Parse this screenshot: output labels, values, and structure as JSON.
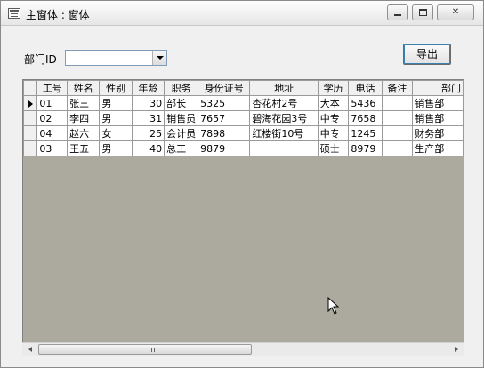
{
  "window": {
    "title": "主窗体 : 窗体"
  },
  "form": {
    "dept_label": "部门ID",
    "dept_value": "",
    "export_label": "导出"
  },
  "grid": {
    "columns": [
      "工号",
      "姓名",
      "性别",
      "年龄",
      "职务",
      "身份证号",
      "地址",
      "学历",
      "电话",
      "备注",
      "部门"
    ],
    "rows": [
      [
        "01",
        "张三",
        "男",
        "30",
        "部长",
        "5325",
        "杏花村2号",
        "大本",
        "5436",
        "",
        "销售部"
      ],
      [
        "02",
        "李四",
        "男",
        "31",
        "销售员",
        "7657",
        "碧海花园3号",
        "中专",
        "7658",
        "",
        "销售部"
      ],
      [
        "04",
        "赵六",
        "女",
        "25",
        "会计员",
        "7898",
        "红楼街10号",
        "中专",
        "1245",
        "",
        "财务部"
      ],
      [
        "03",
        "王五",
        "男",
        "40",
        "总工",
        "9879",
        "",
        "硕士",
        "8979",
        "",
        "生产部"
      ]
    ],
    "current_row": 0
  },
  "colors": {
    "grid_empty_area": "#acaa9f",
    "header_bg": "#f0f0f0",
    "window_bg": "#f0f0f0"
  }
}
